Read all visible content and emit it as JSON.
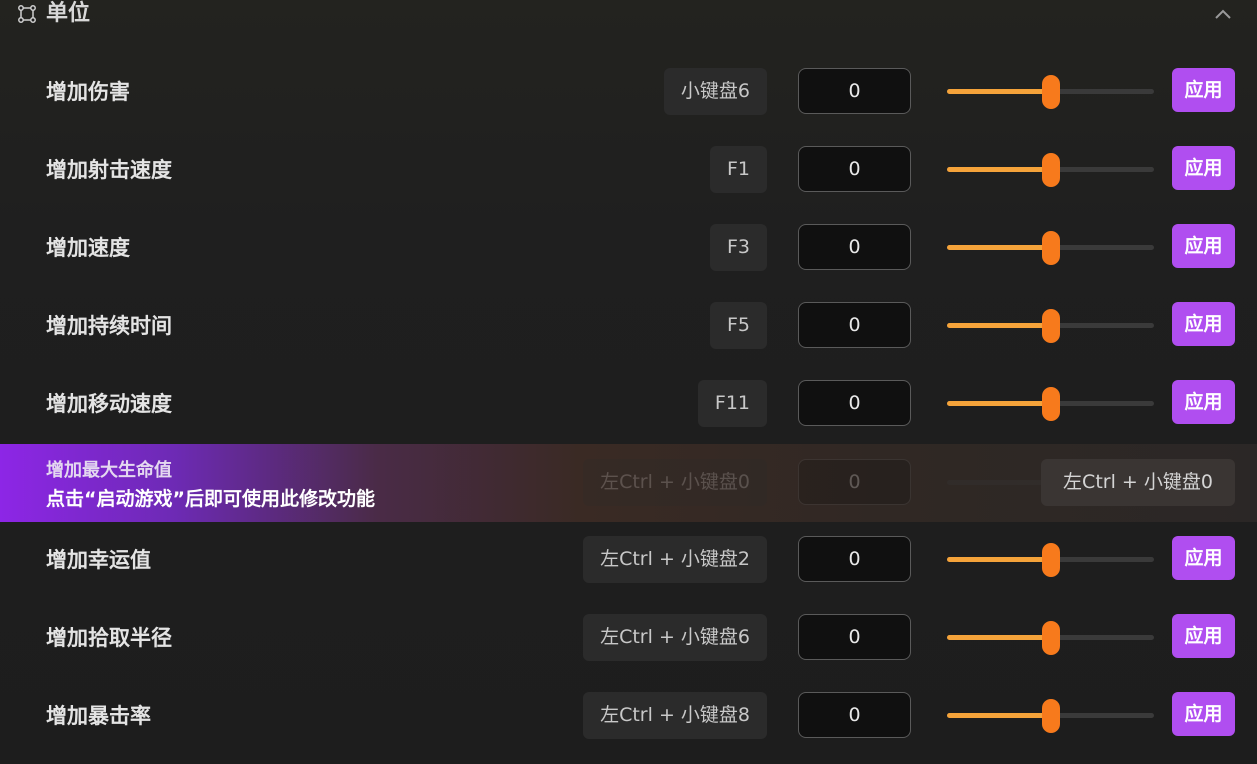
{
  "section": {
    "title": "单位"
  },
  "rows": [
    {
      "label": "增加伤害",
      "hotkey": "小键盘6",
      "value": "0",
      "slider_fraction": 0.5,
      "apply": "应用"
    },
    {
      "label": "增加射击速度",
      "hotkey": "F1",
      "value": "0",
      "slider_fraction": 0.5,
      "apply": "应用"
    },
    {
      "label": "增加速度",
      "hotkey": "F3",
      "value": "0",
      "slider_fraction": 0.5,
      "apply": "应用"
    },
    {
      "label": "增加持续时间",
      "hotkey": "F5",
      "value": "0",
      "slider_fraction": 0.5,
      "apply": "应用"
    },
    {
      "label": "增加移动速度",
      "hotkey": "F11",
      "value": "0",
      "slider_fraction": 0.5,
      "apply": "应用"
    },
    {
      "label": "增加幸运值",
      "hotkey": "左Ctrl + 小键盘2",
      "value": "0",
      "slider_fraction": 0.5,
      "apply": "应用"
    },
    {
      "label": "增加拾取半径",
      "hotkey": "左Ctrl + 小键盘6",
      "value": "0",
      "slider_fraction": 0.5,
      "apply": "应用"
    },
    {
      "label": "增加暴击率",
      "hotkey": "左Ctrl + 小键盘8",
      "value": "0",
      "slider_fraction": 0.5,
      "apply": "应用"
    }
  ],
  "locked_row": {
    "label": "增加最大生命值",
    "notice": "点击“启动游戏”后即可使用此修改功能",
    "hotkey": "左Ctrl + 小键盘0",
    "value": "0"
  },
  "colors": {
    "accent": "#b04ef0",
    "slider_fill": "#f5a33a",
    "slider_thumb": "#f77a1c"
  }
}
